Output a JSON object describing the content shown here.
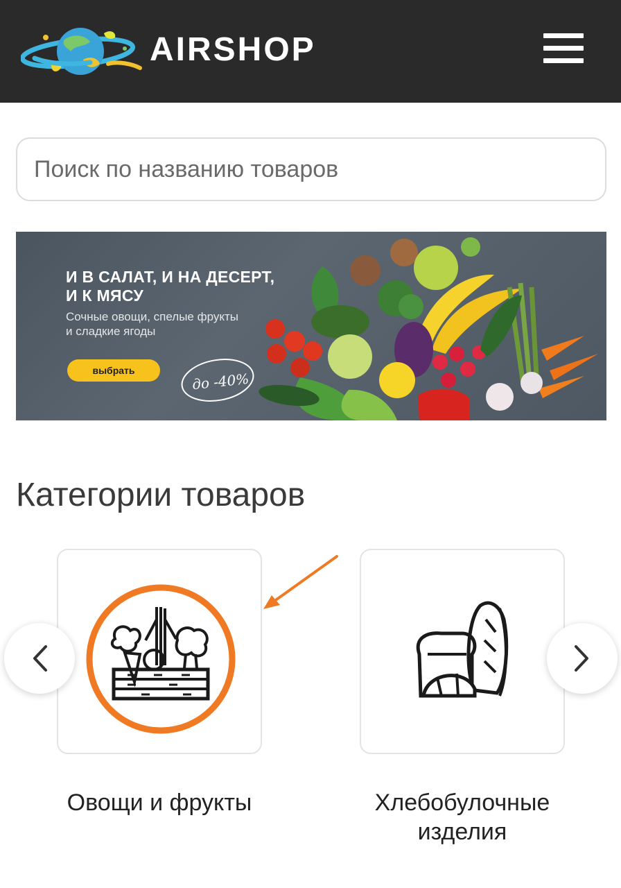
{
  "header": {
    "brand": "AIRSHOP",
    "logo_icon": "planet-logo-icon",
    "menu_icon": "hamburger-menu-icon",
    "background": "#2a2a2a"
  },
  "search": {
    "placeholder": "Поиск по названию товаров",
    "value": ""
  },
  "banner": {
    "title_line1": "И В САЛАТ, И НА ДЕСЕРТ,",
    "title_line2": "И К МЯСУ",
    "subtitle_line1": "Сочные овощи, спелые фрукты",
    "subtitle_line2": "и сладкие ягоды",
    "button_label": "выбрать",
    "discount": "до -40%",
    "accent": "#f7c21b"
  },
  "categories": {
    "title": "Категории товаров",
    "items": [
      {
        "label": "Овощи и фрукты",
        "icon": "vegetable-crate-icon",
        "highlighted": true
      },
      {
        "label_line1": "Хлебобулочные",
        "label_line2": "изделия",
        "icon": "bread-icon",
        "highlighted": false
      }
    ],
    "prev_icon": "chevron-left-icon",
    "next_icon": "chevron-right-icon",
    "highlight_color": "#f07a23"
  }
}
